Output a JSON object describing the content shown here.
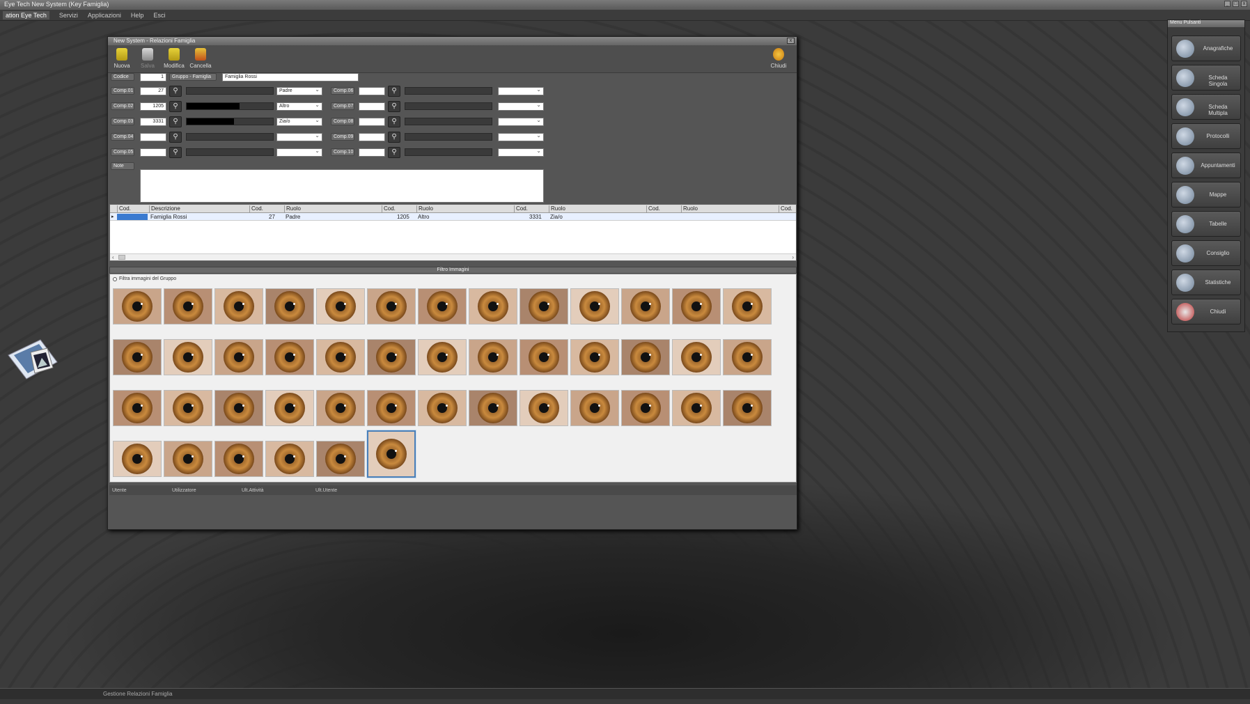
{
  "app": {
    "title": "Eye Tech New System (Key Famiglia)",
    "window_controls": [
      "_",
      "□",
      "x"
    ]
  },
  "menubar": [
    "ation Eye Tech",
    "Servizi",
    "Applicazioni",
    "Help",
    "Esci"
  ],
  "window": {
    "title": "New System - Relazioni Famiglia",
    "close": "x"
  },
  "toolbar": {
    "nuova": "Nuova",
    "salva": "Salva",
    "modifica": "Modifica",
    "cancella": "Cancella",
    "chiudi": "Chiudi"
  },
  "form": {
    "codice_label": "Codice",
    "codice_value": "1",
    "gruppo_label": "Gruppo - Famiglia",
    "gruppo_value": "Famiglia Rossi",
    "comp_labels": [
      "Comp.01",
      "Comp.02",
      "Comp.03",
      "Comp.04",
      "Comp.05",
      "Comp.06",
      "Comp.07",
      "Comp.08",
      "Comp.09",
      "Comp.10"
    ],
    "comp_values": [
      "27",
      "1205",
      "3331",
      "",
      "",
      "",
      "",
      "",
      "",
      ""
    ],
    "ruoli": [
      "Padre",
      "Altro",
      "Zia/o",
      "",
      "",
      "",
      "",
      "",
      "",
      ""
    ],
    "note_label": "Note"
  },
  "grid": {
    "headers": [
      "Cod.",
      "Descrizione",
      "Cod.",
      "Ruolo",
      "Cod.",
      "Ruolo",
      "Cod.",
      "Ruolo",
      "Cod.",
      "Ruolo",
      "Cod."
    ],
    "row": {
      "descrizione": "Famiglia Rossi",
      "cod1": "27",
      "ruolo1": "Padre",
      "cod2": "1205",
      "ruolo2": "Altro",
      "cod3": "3331",
      "ruolo3": "Zia/o"
    }
  },
  "gallery": {
    "bar_label": "Filtro Immagini",
    "option_label": "Filtra immagini del Gruppo",
    "count": 45,
    "selected_index": 44
  },
  "statusrow": [
    "Utente",
    "Utilizzatore",
    "Ult.Attività",
    "Ult.Utente"
  ],
  "side_panel": {
    "title": "Menu Pulsanti",
    "items": [
      "Anagrafiche",
      "Scheda Singola",
      "Scheda Multipla",
      "Protocolli",
      "Appuntamenti",
      "Mappe",
      "Tabelle",
      "Consiglio",
      "Statistiche",
      "Chiudi"
    ]
  },
  "taskbar": {
    "text": "Gestione Relazioni Famiglia"
  },
  "colors": {
    "iris_light": "#c98a3e",
    "iris_dark": "#7a4a1c",
    "selection": "#4a7fb8"
  }
}
